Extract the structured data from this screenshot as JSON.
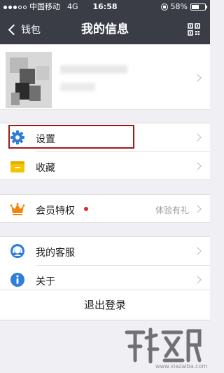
{
  "status_bar": {
    "carrier": "中国移动",
    "network": "4G",
    "time": "16:58",
    "battery_percent": "58%",
    "battery_level": 0.58
  },
  "nav": {
    "back_label": "钱包",
    "title": "我的信息",
    "qr_icon": "qr-code-icon"
  },
  "menu": {
    "settings": {
      "label": "设置",
      "icon": "gear-icon",
      "color": "#2f7fd9"
    },
    "favorites": {
      "label": "收藏",
      "icon": "folder-icon",
      "color": "#f5c400"
    },
    "vip": {
      "label": "会员特权",
      "extra": "体验有礼",
      "icon": "crown-icon",
      "color": "#f0860b",
      "badge_color": "#e6262e"
    },
    "support": {
      "label": "我的客服",
      "icon": "headset-icon",
      "color": "#2f7fd9"
    },
    "about": {
      "label": "关于",
      "icon": "info-icon",
      "color": "#2f7fd9"
    }
  },
  "logout_label": "退出登录",
  "watermark": {
    "url": "www.xiazaiba.com"
  },
  "colors": {
    "header": "#3a3d46",
    "background": "#efeff4",
    "highlight": "#a01a1a"
  }
}
